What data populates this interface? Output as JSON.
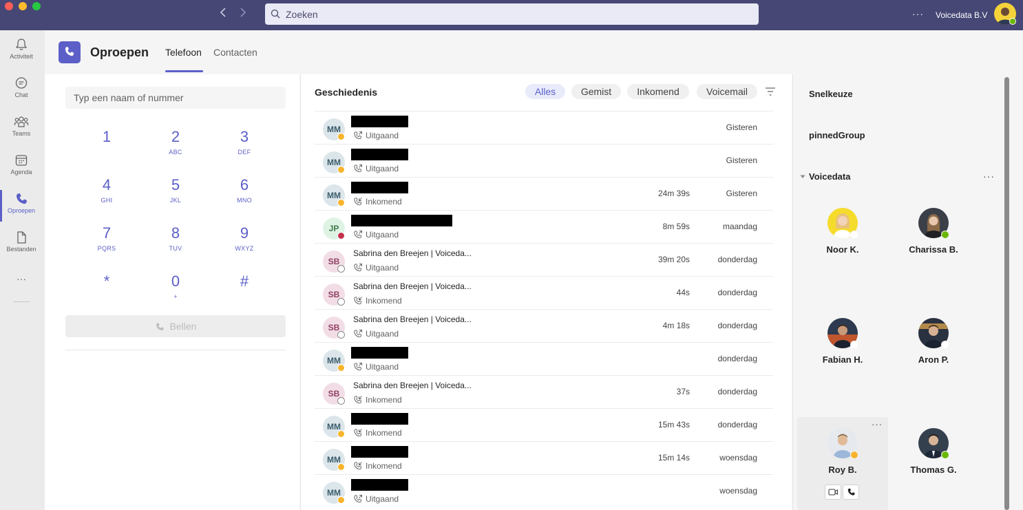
{
  "window": {
    "search_placeholder": "Zoeken",
    "org_name": "Voicedata B.V",
    "more": "···"
  },
  "rail": {
    "items": [
      {
        "label": "Activiteit",
        "icon": "bell-icon"
      },
      {
        "label": "Chat",
        "icon": "chat-icon"
      },
      {
        "label": "Teams",
        "icon": "teams-icon"
      },
      {
        "label": "Agenda",
        "icon": "calendar-icon"
      },
      {
        "label": "Oproepen",
        "icon": "phone-icon"
      },
      {
        "label": "Bestanden",
        "icon": "file-icon"
      }
    ],
    "more": "···"
  },
  "header": {
    "title": "Oproepen",
    "tabs": [
      "Telefoon",
      "Contacten"
    ]
  },
  "dialpad": {
    "placeholder": "Typ een naam of nummer",
    "keys": [
      {
        "digit": "1",
        "sub": ""
      },
      {
        "digit": "2",
        "sub": "ABC"
      },
      {
        "digit": "3",
        "sub": "DEF"
      },
      {
        "digit": "4",
        "sub": "GHI"
      },
      {
        "digit": "5",
        "sub": "JKL"
      },
      {
        "digit": "6",
        "sub": "MNO"
      },
      {
        "digit": "7",
        "sub": "PQRS"
      },
      {
        "digit": "8",
        "sub": "TUV"
      },
      {
        "digit": "9",
        "sub": "WXYZ"
      },
      {
        "digit": "*",
        "sub": ""
      },
      {
        "digit": "0",
        "sub": "+"
      },
      {
        "digit": "#",
        "sub": ""
      }
    ],
    "call_label": "Bellen"
  },
  "history": {
    "title": "Geschiedenis",
    "filters": [
      "Alles",
      "Gemist",
      "Inkomend",
      "Voicemail"
    ],
    "rows": [
      {
        "initials": "MM",
        "name": "",
        "direction": "Uitgaand",
        "duration": "",
        "date": "Gisteren",
        "status": "away"
      },
      {
        "initials": "MM",
        "name": "",
        "direction": "Uitgaand",
        "duration": "",
        "date": "Gisteren",
        "status": "away"
      },
      {
        "initials": "MM",
        "name": "",
        "direction": "Inkomend",
        "duration": "24m 39s",
        "date": "Gisteren",
        "status": "away"
      },
      {
        "initials": "JP",
        "name": "",
        "direction": "Uitgaand",
        "duration": "8m 59s",
        "date": "maandag",
        "status": "busy"
      },
      {
        "initials": "SB",
        "name": "Sabrina den Breejen | Voiceda...",
        "direction": "Uitgaand",
        "duration": "39m 20s",
        "date": "donderdag",
        "status": "offline"
      },
      {
        "initials": "SB",
        "name": "Sabrina den Breejen | Voiceda...",
        "direction": "Inkomend",
        "duration": "44s",
        "date": "donderdag",
        "status": "offline"
      },
      {
        "initials": "SB",
        "name": "Sabrina den Breejen | Voiceda...",
        "direction": "Uitgaand",
        "duration": "4m 18s",
        "date": "donderdag",
        "status": "offline"
      },
      {
        "initials": "MM",
        "name": "",
        "direction": "Uitgaand",
        "duration": "",
        "date": "donderdag",
        "status": "away"
      },
      {
        "initials": "SB",
        "name": "Sabrina den Breejen | Voiceda...",
        "direction": "Inkomend",
        "duration": "37s",
        "date": "donderdag",
        "status": "offline"
      },
      {
        "initials": "MM",
        "name": "",
        "direction": "Inkomend",
        "duration": "15m 43s",
        "date": "donderdag",
        "status": "away"
      },
      {
        "initials": "MM",
        "name": "",
        "direction": "Inkomend",
        "duration": "15m 14s",
        "date": "woensdag",
        "status": "away"
      },
      {
        "initials": "MM",
        "name": "",
        "direction": "Uitgaand",
        "duration": "",
        "date": "woensdag",
        "status": "away"
      }
    ]
  },
  "speed_dial": {
    "title": "Snelkeuze",
    "pinned_group": "pinnedGroup",
    "group_name": "Voicedata",
    "group_more": "···",
    "contacts": [
      {
        "name": "Noor K.",
        "status": "offline"
      },
      {
        "name": "Charissa B.",
        "status": "available"
      },
      {
        "name": "Fabian H.",
        "status": "offline"
      },
      {
        "name": "Aron P.",
        "status": "offline"
      },
      {
        "name": "Roy B.",
        "status": "away"
      },
      {
        "name": "Thomas G.",
        "status": "available"
      }
    ],
    "contact_more": "···"
  },
  "colors": {
    "titlebar": "#464775",
    "accent": "#5b5fc7",
    "away": "#f8b42c",
    "busy": "#c4314b",
    "available": "#6bb700"
  }
}
